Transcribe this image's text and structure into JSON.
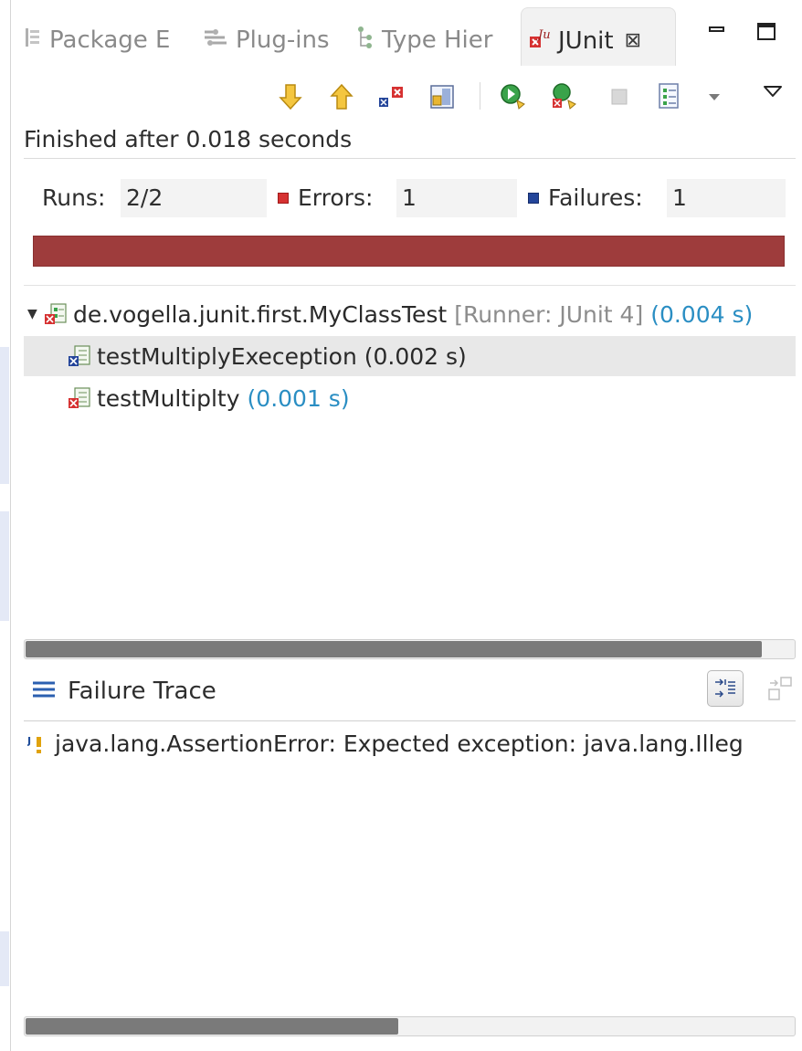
{
  "tabs": [
    {
      "label": "Package E",
      "icon": "package-explorer-icon"
    },
    {
      "label": "Plug-ins",
      "icon": "plugins-icon"
    },
    {
      "label": "Type Hier",
      "icon": "type-hierarchy-icon"
    },
    {
      "label": "JUnit",
      "icon": "junit-icon",
      "active": true
    }
  ],
  "toolbar": {
    "buttons": [
      "next-failure-icon",
      "previous-failure-icon",
      "show-failures-only-icon",
      "scroll-lock-icon",
      "rerun-test-icon",
      "rerun-failed-first-icon",
      "stop-icon",
      "test-run-history-icon",
      "history-dropdown-icon",
      "view-menu-icon"
    ]
  },
  "status": "Finished after 0.018 seconds",
  "counters": {
    "runs_label": "Runs:",
    "runs_value": "2/2",
    "errors_label": "Errors:",
    "errors_value": "1",
    "failures_label": "Failures:",
    "failures_value": "1"
  },
  "progress": {
    "fraction": 1.0,
    "color": "#9e3c3c"
  },
  "tree": {
    "suite": {
      "name": "de.vogella.junit.first.MyClassTest",
      "runner": "[Runner: JUnit 4]",
      "time": "(0.004 s)"
    },
    "tests": [
      {
        "name": "testMultiplyExeception (0.002 s)",
        "time": "",
        "status": "failure",
        "selected": true
      },
      {
        "name": "testMultiplty",
        "time": "(0.001 s)",
        "status": "error",
        "selected": false
      }
    ]
  },
  "failure_trace": {
    "title": "Failure Trace",
    "lines": [
      "java.lang.AssertionError: Expected exception: java.lang.Illeg"
    ]
  },
  "colors": {
    "error": "#d63131",
    "failure": "#24459a",
    "time": "#2a8ec3",
    "runner": "#8c8c8c"
  }
}
